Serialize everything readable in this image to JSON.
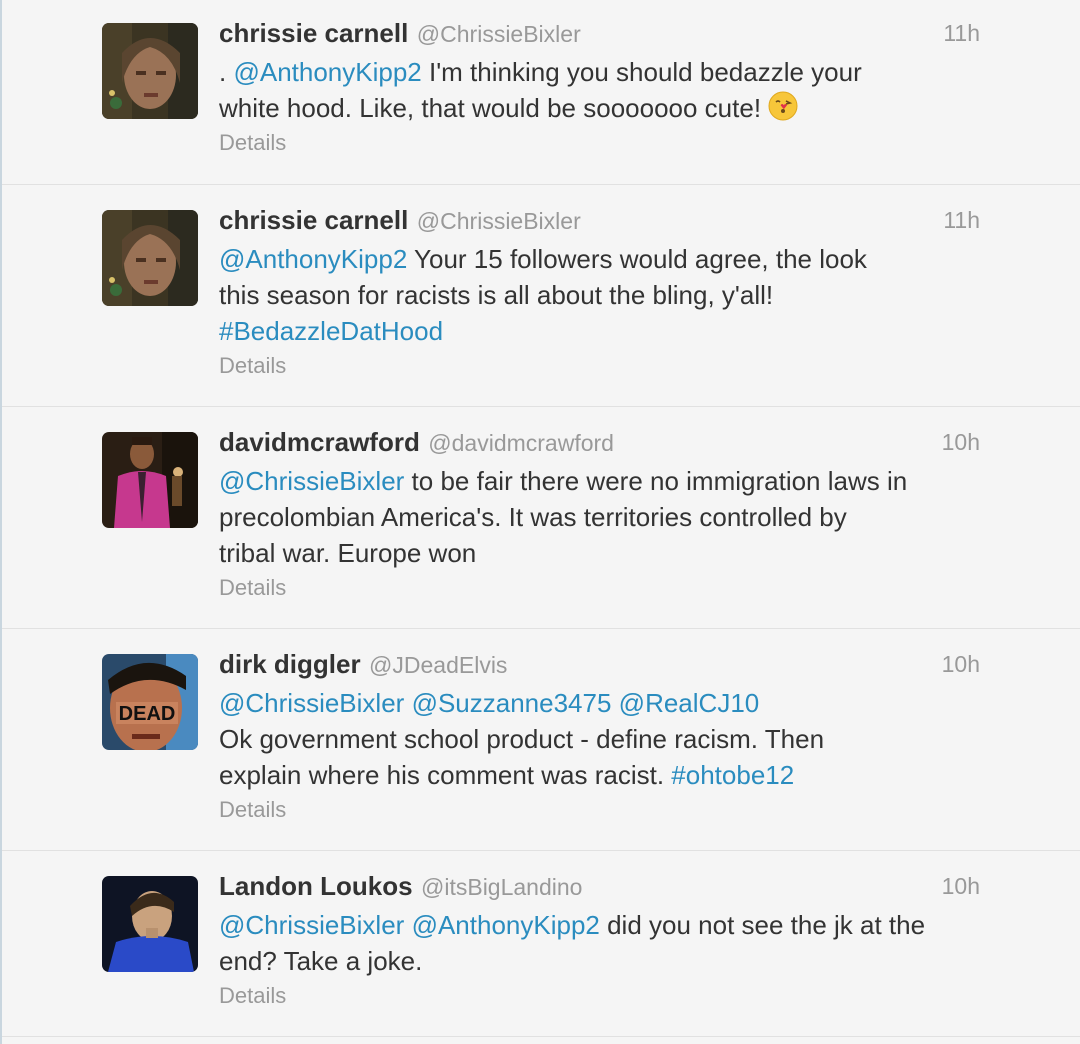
{
  "tweets": [
    {
      "fullname": "chrissie carnell",
      "screen_name": "@ChrissieBixler",
      "time": "11h",
      "lines": [
        [
          {
            "t": ". ",
            "k": "text"
          },
          {
            "t": "@AnthonyKipp2",
            "k": "mention"
          },
          {
            "t": " I'm thinking you should bedazzle your",
            "k": "text"
          }
        ],
        [
          {
            "t": "white hood. Like, that would be sooooooo cute! ",
            "k": "text"
          }
        ]
      ],
      "has_emoji": true,
      "emoji_icon": "kiss-emoji-icon",
      "details": "Details",
      "avatar_icon": "avatar-woman-icon"
    },
    {
      "fullname": "chrissie carnell",
      "screen_name": "@ChrissieBixler",
      "time": "11h",
      "lines": [
        [
          {
            "t": "@AnthonyKipp2",
            "k": "mention"
          },
          {
            "t": " Your 15 followers would agree, the look",
            "k": "text"
          }
        ],
        [
          {
            "t": "this season for racists is all about the bling, y'all!",
            "k": "text"
          }
        ],
        [
          {
            "t": "#BedazzleDatHood",
            "k": "hashtag"
          }
        ]
      ],
      "has_emoji": false,
      "details": "Details",
      "avatar_icon": "avatar-woman-icon"
    },
    {
      "fullname": "davidmcrawford",
      "screen_name": "@davidmcrawford",
      "time": "10h",
      "lines": [
        [
          {
            "t": "@ChrissieBixler",
            "k": "mention"
          },
          {
            "t": " to be fair there were no immigration laws in",
            "k": "text"
          }
        ],
        [
          {
            "t": "precolombian America's. It was territories controlled by",
            "k": "text"
          }
        ],
        [
          {
            "t": "tribal war. Europe won",
            "k": "text"
          }
        ]
      ],
      "has_emoji": false,
      "details": "Details",
      "avatar_icon": "avatar-man-pink-shirt-icon"
    },
    {
      "fullname": "dirk diggler",
      "screen_name": "@JDeadElvis",
      "time": "10h",
      "lines": [
        [
          {
            "t": "@ChrissieBixler",
            "k": "mention"
          },
          {
            "t": " ",
            "k": "text"
          },
          {
            "t": "@Suzzanne3475",
            "k": "mention"
          },
          {
            "t": " ",
            "k": "text"
          },
          {
            "t": "@RealCJ10",
            "k": "mention"
          }
        ],
        [
          {
            "t": "Ok government school product - define racism.  Then",
            "k": "text"
          }
        ],
        [
          {
            "t": "explain where his comment was racist. ",
            "k": "text"
          },
          {
            "t": "#ohtobe12",
            "k": "hashtag"
          }
        ]
      ],
      "has_emoji": false,
      "details": "Details",
      "avatar_icon": "avatar-dead-face-icon",
      "avatar_text": "DEAD"
    },
    {
      "fullname": "Landon Loukos",
      "screen_name": "@itsBigLandino",
      "time": "10h",
      "lines": [
        [
          {
            "t": "@ChrissieBixler",
            "k": "mention"
          },
          {
            "t": " ",
            "k": "text"
          },
          {
            "t": "@AnthonyKipp2",
            "k": "mention"
          },
          {
            "t": " did you not see the jk at the",
            "k": "text"
          }
        ],
        [
          {
            "t": "end? Take a joke.",
            "k": "text"
          }
        ]
      ],
      "has_emoji": false,
      "details": "Details",
      "avatar_icon": "avatar-young-man-icon"
    }
  ],
  "colors": {
    "link": "#2a8cbf",
    "meta": "#999999",
    "text": "#333333",
    "background": "#f5f5f5"
  }
}
